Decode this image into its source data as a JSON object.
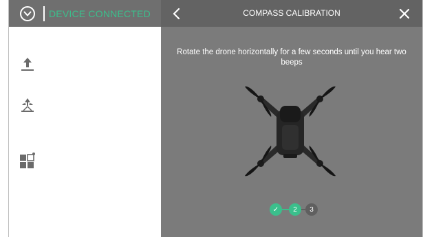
{
  "status": {
    "text": "DEVICE CONNECTED",
    "color": "#3bbf8c",
    "logo_icon": "chevron-circle-icon"
  },
  "sidebar": {
    "items": [
      {
        "icon": "upload-icon"
      },
      {
        "icon": "drone-return-icon"
      },
      {
        "icon": "apps-grid-icon"
      }
    ]
  },
  "panel": {
    "title": "COMPASS CALIBRATION",
    "instruction": "Rotate the drone horizontally for a few seconds until you hear two beeps",
    "back_icon": "chevron-left-icon",
    "close_icon": "close-icon"
  },
  "steps": {
    "items": [
      {
        "label": "✓",
        "state": "done"
      },
      {
        "label": "2",
        "state": "current"
      },
      {
        "label": "3",
        "state": "pending"
      }
    ],
    "accent": "#3bbf8c"
  }
}
